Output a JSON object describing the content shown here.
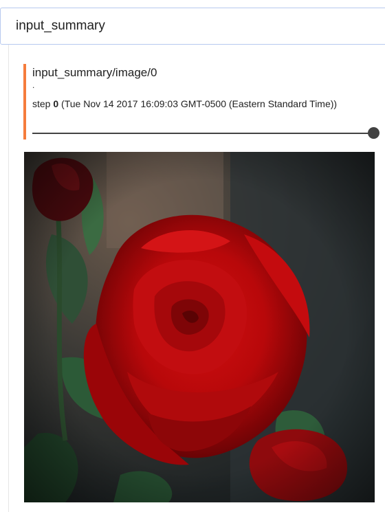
{
  "group": {
    "title": "input_summary"
  },
  "card": {
    "title": "input_summary/image/0",
    "run_marker": ".",
    "step_label": "step",
    "step_value": "0",
    "step_timestamp": "(Tue Nov 14 2017 16:09:03 GMT-0500 (Eastern Standard Time))"
  },
  "slider": {
    "value_fraction": 1.0
  },
  "colors": {
    "accent": "#f57c3c",
    "header_border": "#b6c9ef",
    "slider": "#424242"
  },
  "image": {
    "subject": "red rose photograph"
  }
}
